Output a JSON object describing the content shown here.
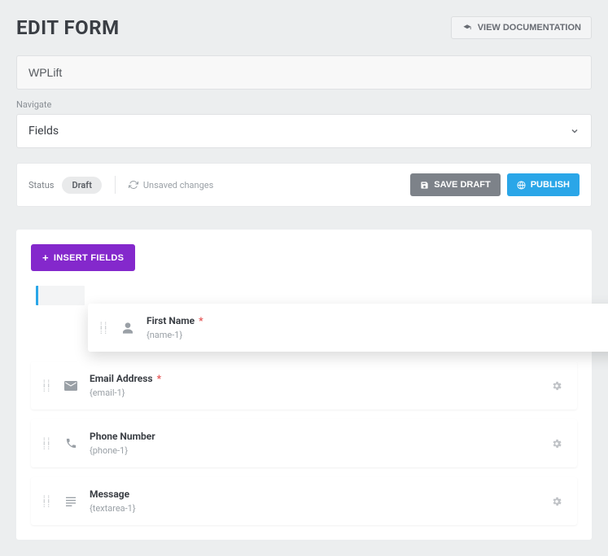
{
  "header": {
    "title": "EDIT FORM",
    "doc_button": "VIEW DOCUMENTATION"
  },
  "form_name": "WPLift",
  "navigate_label": "Navigate",
  "navigate_value": "Fields",
  "status_bar": {
    "status_label": "Status",
    "status_value": "Draft",
    "unsaved": "Unsaved changes",
    "save_draft": "SAVE DRAFT",
    "publish": "PUBLISH"
  },
  "insert_fields": "INSERT FIELDS",
  "fields": [
    {
      "label": "First Name",
      "merge": "{name-1}",
      "required": true,
      "icon": "person"
    },
    {
      "label": "Email Address",
      "merge": "{email-1}",
      "required": true,
      "icon": "mail"
    },
    {
      "label": "Phone Number",
      "merge": "{phone-1}",
      "required": false,
      "icon": "phone"
    },
    {
      "label": "Message",
      "merge": "{textarea-1}",
      "required": false,
      "icon": "textarea"
    }
  ]
}
